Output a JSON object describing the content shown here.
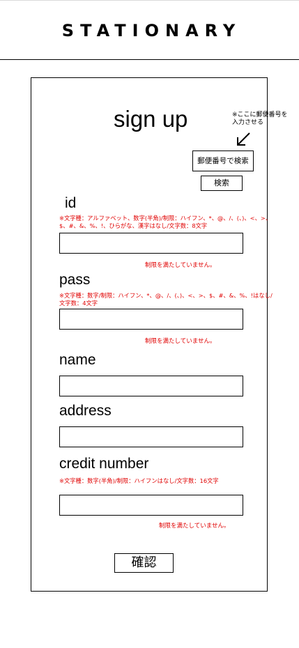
{
  "header": {
    "brand": "STATIONARY"
  },
  "form": {
    "title": "sign up",
    "postal_note": "※ここに郵便番号を入力させる",
    "postal_search_label": "郵便番号で検索",
    "search_label": "検索",
    "id": {
      "label": "id",
      "rule": "※文字種：アルファベット、数字(半角)/制限：ハイフン、*、@、/、(、)、<、>、$、#、&、%、!、ひらがな、漢字はなし/文字数：8文字",
      "value": "",
      "error": "制限を満たしていません。"
    },
    "pass": {
      "label": "pass",
      "rule": "※文字種：数字/制限：ハイフン、*、@、/、(、)、<、>、$、#、&、%、!はなし/文字数：4文字",
      "value": "",
      "error": "制限を満たしていません。"
    },
    "name": {
      "label": "name",
      "value": ""
    },
    "address": {
      "label": "address",
      "value": ""
    },
    "credit": {
      "label": "credit number",
      "rule": "※文字種：数字(半角)/制限：ハイフンはなし/文字数：16文字",
      "value": "",
      "error": "制限を満たしていません。"
    },
    "confirm_label": "確認"
  },
  "colors": {
    "error": "#e00000",
    "border": "#000000",
    "background": "#ffffff"
  },
  "icons": {
    "arrow": "arrow-down-left-icon"
  }
}
